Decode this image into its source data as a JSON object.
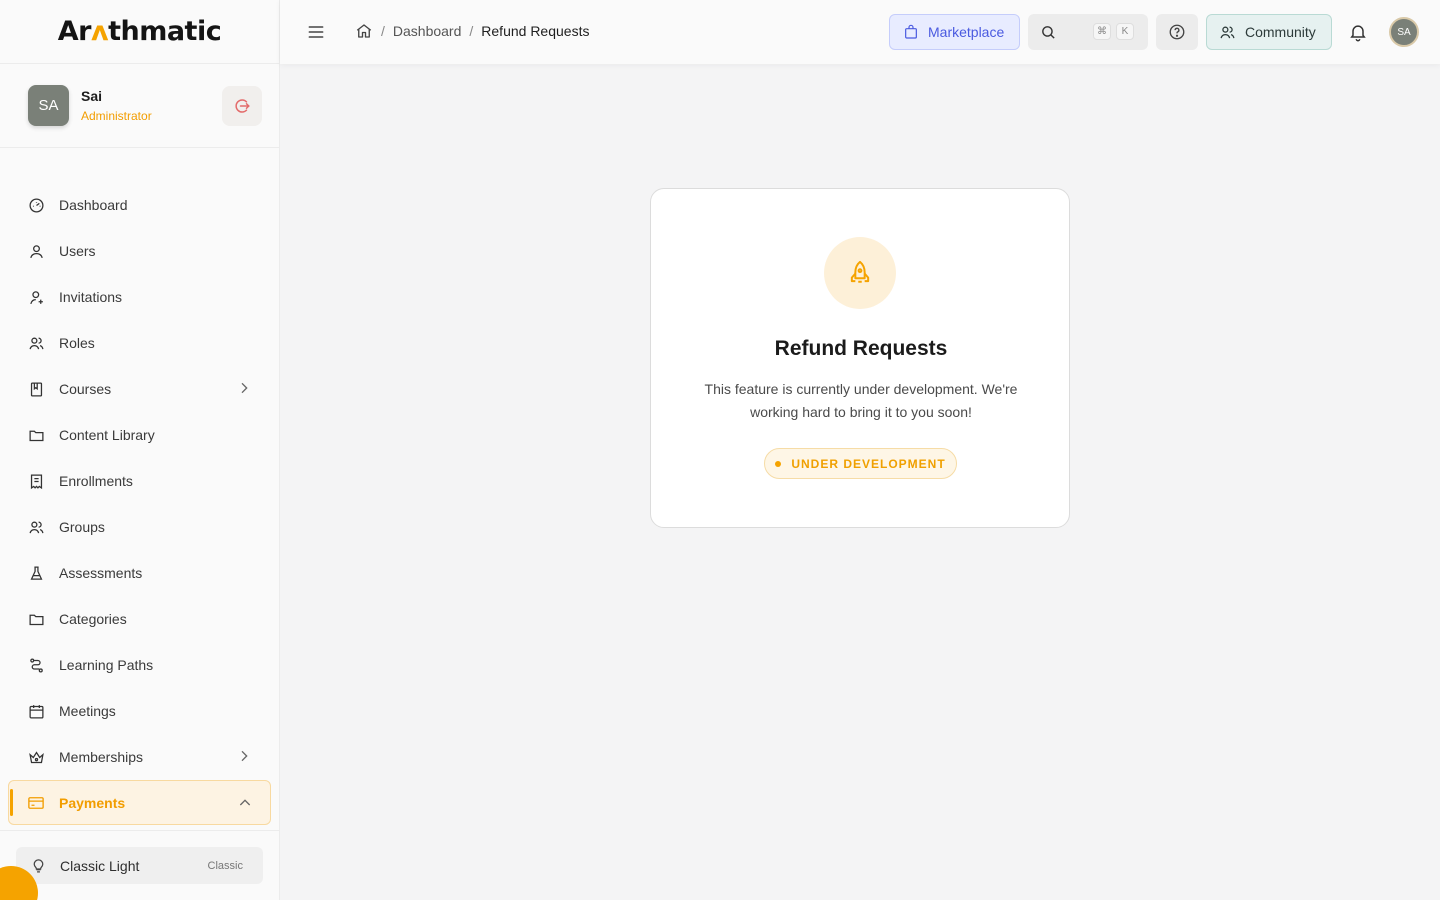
{
  "brand": {
    "logo_prefix": "Ar",
    "logo_accent": "ʌ",
    "logo_suffix": "thmatic",
    "accent_color": "#f5a300"
  },
  "profile": {
    "initials": "SA",
    "name": "Sai",
    "role": "Administrator"
  },
  "nav": {
    "items": [
      {
        "label": "Dashboard",
        "icon": "dashboard-icon"
      },
      {
        "label": "Users",
        "icon": "user-icon"
      },
      {
        "label": "Invitations",
        "icon": "user-plus-icon"
      },
      {
        "label": "Roles",
        "icon": "users-icon"
      },
      {
        "label": "Courses",
        "icon": "book-icon",
        "expandable": true
      },
      {
        "label": "Content Library",
        "icon": "folder-icon"
      },
      {
        "label": "Enrollments",
        "icon": "receipt-icon"
      },
      {
        "label": "Groups",
        "icon": "users-icon"
      },
      {
        "label": "Assessments",
        "icon": "flask-icon"
      },
      {
        "label": "Categories",
        "icon": "folder-icon"
      },
      {
        "label": "Learning Paths",
        "icon": "route-icon"
      },
      {
        "label": "Meetings",
        "icon": "calendar-icon"
      },
      {
        "label": "Memberships",
        "icon": "crown-icon",
        "expandable": true
      },
      {
        "label": "Payments",
        "icon": "credit-card-icon",
        "expanded": true,
        "active": true
      }
    ]
  },
  "theme": {
    "label": "Classic Light",
    "tag": "Classic"
  },
  "header": {
    "breadcrumb": {
      "home_icon": "home-icon",
      "parent": "Dashboard",
      "current": "Refund Requests",
      "separator": "/"
    },
    "marketplace_label": "Marketplace",
    "search_shortcut": {
      "meta": "⌘",
      "key": "K"
    },
    "community_label": "Community",
    "user_initials": "SA"
  },
  "main": {
    "title": "Refund Requests",
    "description": "This feature is currently under development. We're working hard to bring it to you soon!",
    "badge": "UNDER DEVELOPMENT",
    "icon": "rocket-icon"
  }
}
